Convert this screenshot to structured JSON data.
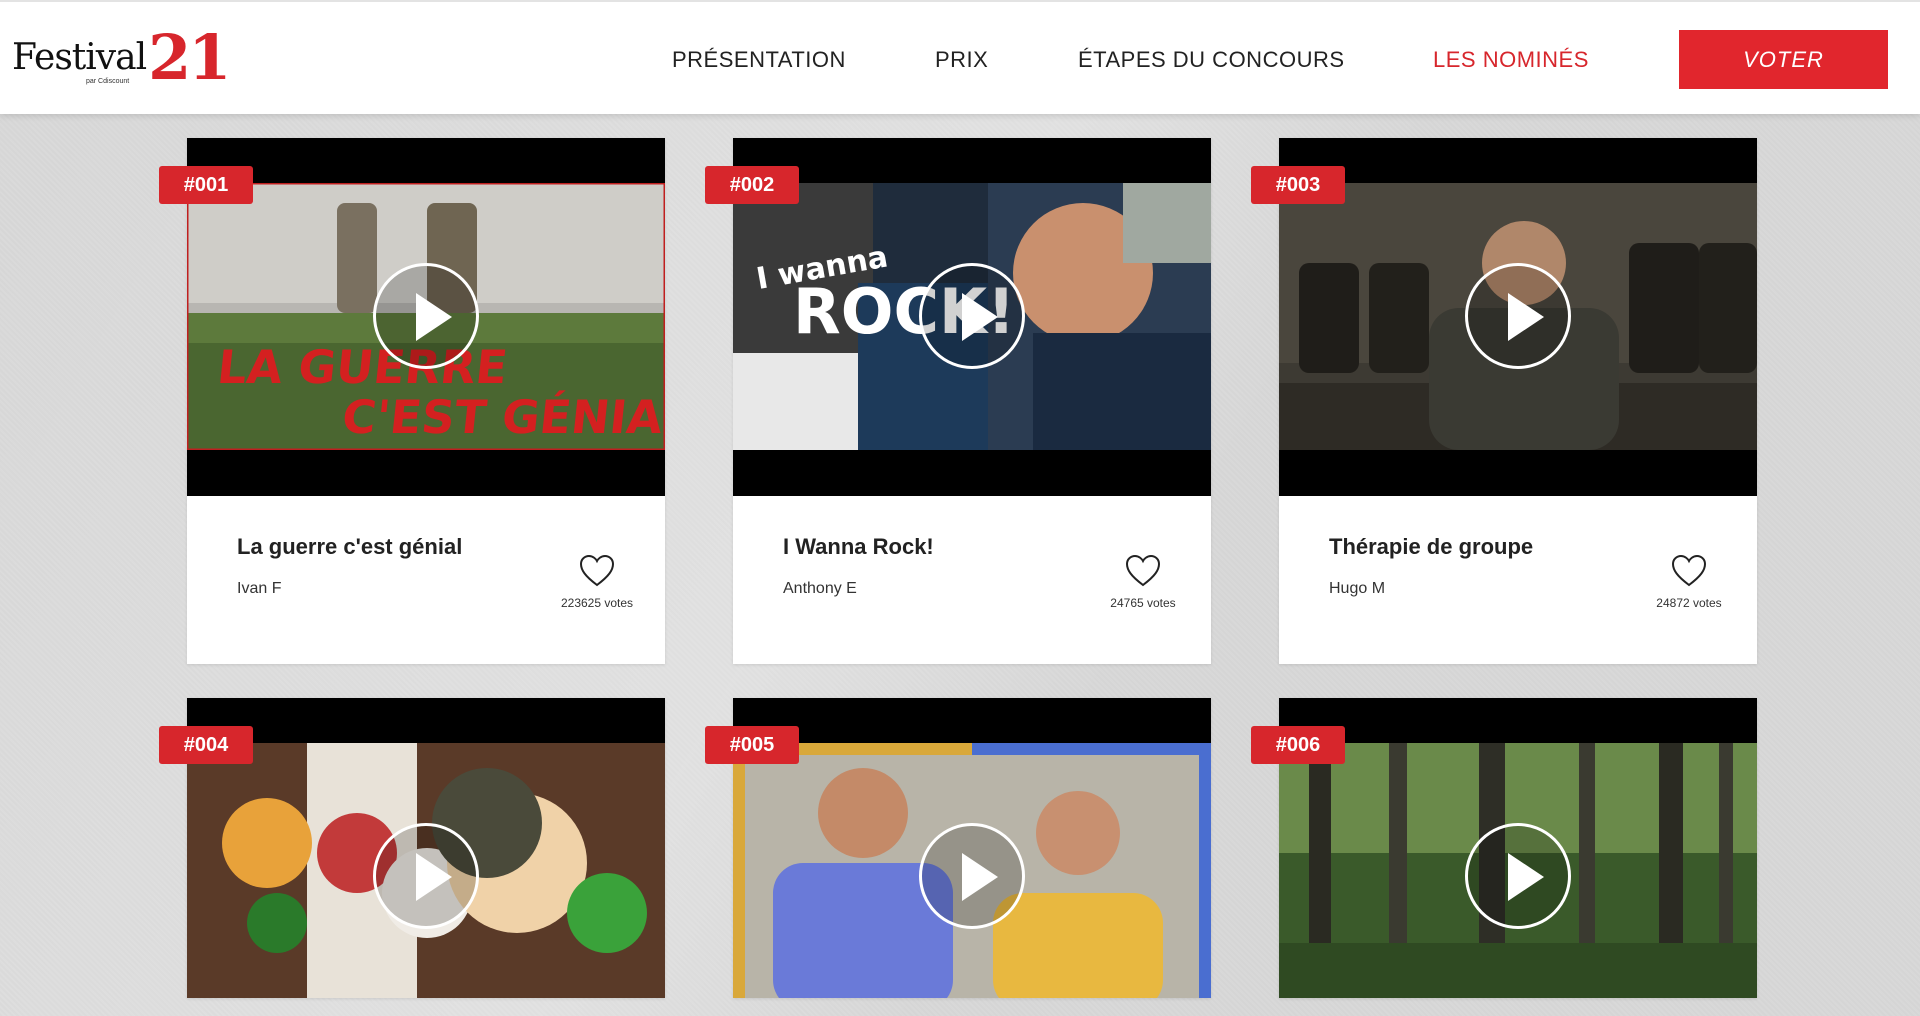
{
  "header": {
    "logo_text": "Festival",
    "logo_number": "21",
    "logo_sub": "par Cdiscount",
    "nav": [
      "PRÉSENTATION",
      "PRIX",
      "ÉTAPES DU CONCOURS",
      "LES NOMINÉS"
    ],
    "vote_label": "VOTER",
    "accent_color": "#d7262c"
  },
  "cards": [
    {
      "badge": "#001",
      "title": "La guerre c'est génial",
      "author": "Ivan F",
      "votes": "223625 votes",
      "thumb_text_1": "LA GUERRE",
      "thumb_text_2": "C'EST GÉNIAL"
    },
    {
      "badge": "#002",
      "title": "I Wanna Rock!",
      "author": "Anthony E",
      "votes": "24765 votes",
      "thumb_text_1": "I wanna",
      "thumb_text_2": "ROCK!"
    },
    {
      "badge": "#003",
      "title": "Thérapie de groupe",
      "author": "Hugo M",
      "votes": "24872 votes"
    },
    {
      "badge": "#004"
    },
    {
      "badge": "#005"
    },
    {
      "badge": "#006"
    }
  ],
  "icons": {
    "play": "play-icon",
    "heart": "heart-icon"
  }
}
